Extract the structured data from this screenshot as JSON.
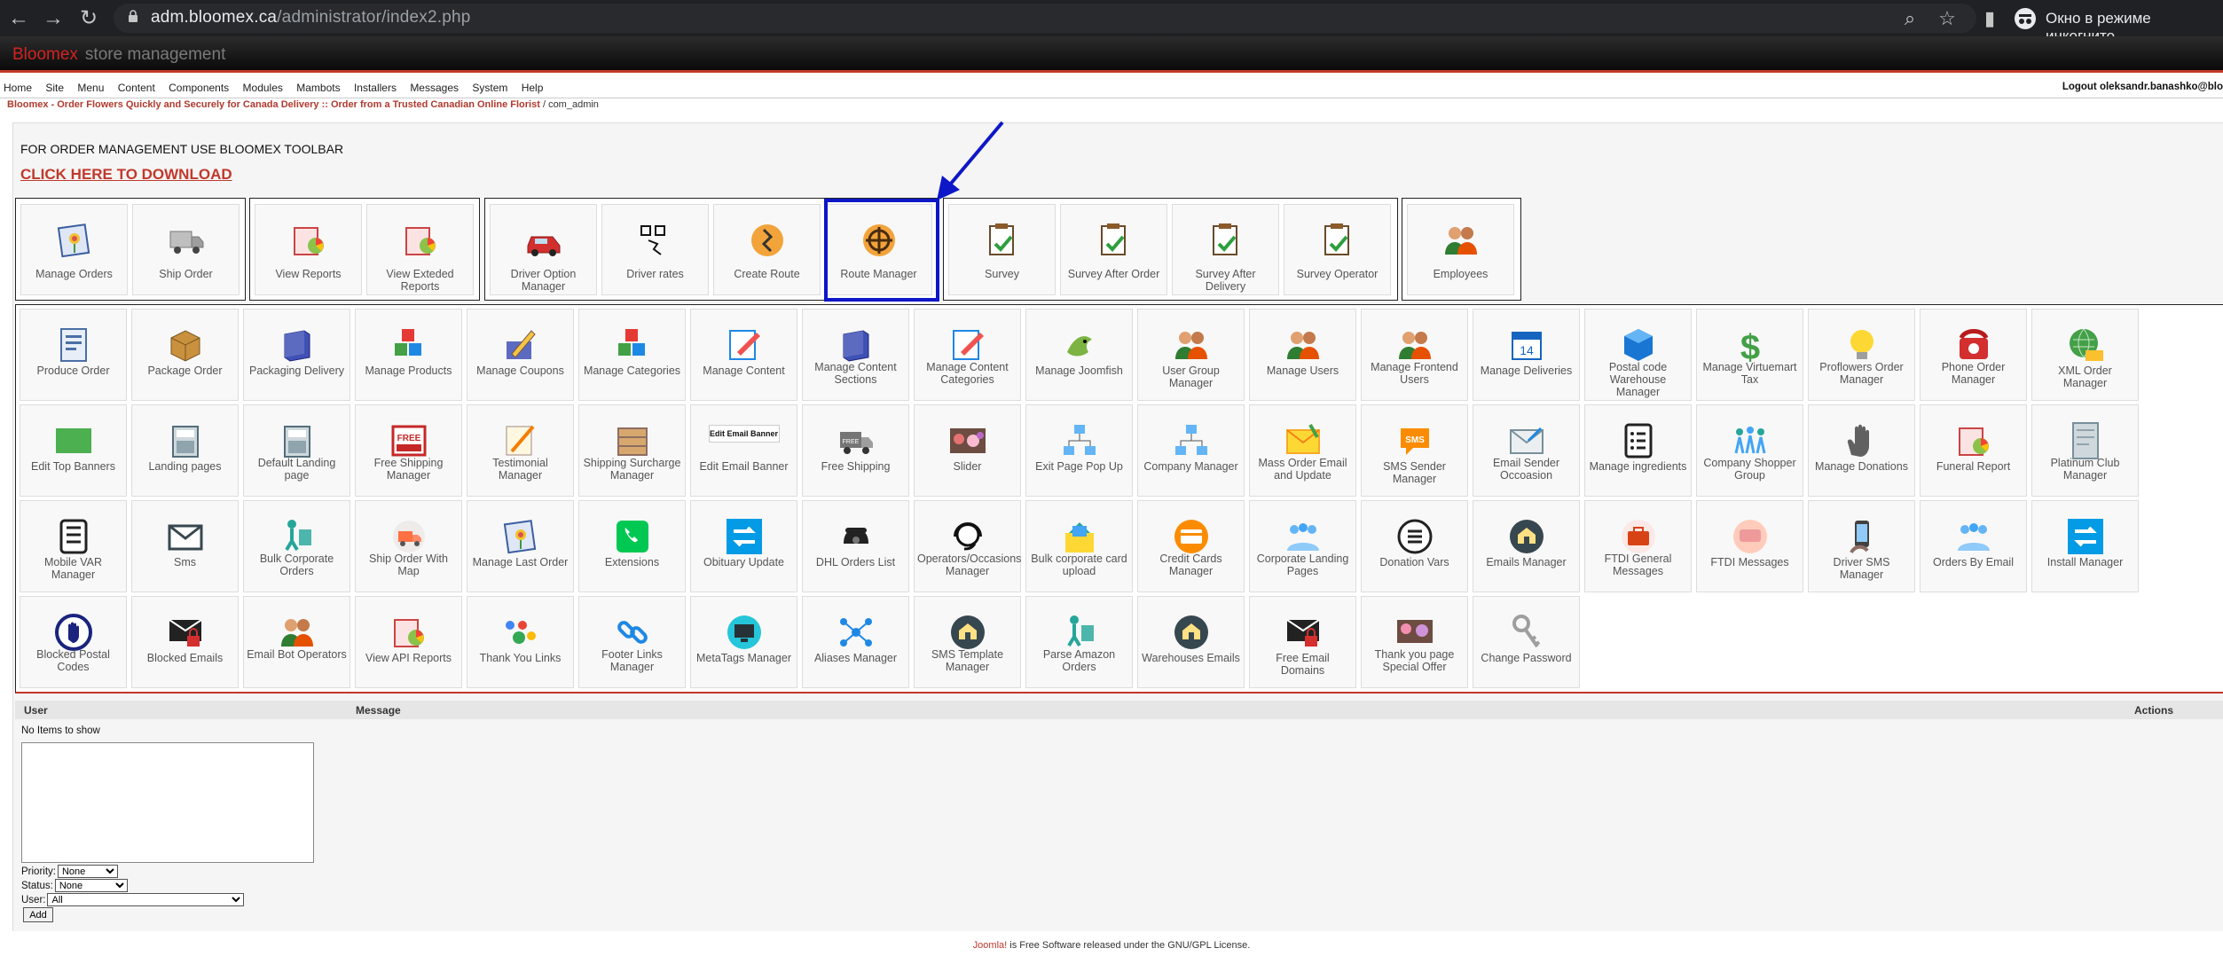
{
  "browser": {
    "url_host": "adm.bloomex.ca",
    "url_path": "/administrator/index2.php",
    "incognito_label": "Окно в режиме инкогнито"
  },
  "header": {
    "brand": "Bloomex",
    "subtitle": "store management"
  },
  "menu": {
    "items": [
      "Home",
      "Site",
      "Menu",
      "Content",
      "Components",
      "Modules",
      "Mambots",
      "Installers",
      "Messages",
      "System",
      "Help"
    ],
    "logout": "Logout oleksandr.banashko@blo"
  },
  "pathway": {
    "link": "Bloomex - Order Flowers Quickly and Securely for Canada Delivery :: Order from a Trusted Canadian Online Florist",
    "current": "/ com_admin"
  },
  "toolbar_note": "FOR ORDER MANAGEMENT USE  BLOOMEX TOOLBAR",
  "download_link": "CLICK HERE TO DOWNLOAD",
  "top_tiles": [
    "Manage Orders",
    "Ship Order",
    "View Reports",
    "View Exteded Reports",
    "Driver Option Manager",
    "Driver rates",
    "Create Route",
    "Route Manager",
    "Survey",
    "Survey After Order",
    "Survey After Delivery",
    "Survey Operator",
    "Employees"
  ],
  "grid_tiles": [
    [
      "Produce Order",
      "Package Order",
      "Packaging Delivery",
      "Manage Products",
      "Manage Coupons",
      "Manage Categories",
      "Manage Content",
      "Manage Content Sections",
      "Manage Content Categories",
      "Manage Joomfish",
      "User Group Manager",
      "Manage Users",
      "Manage Frontend Users",
      "Manage Deliveries",
      "Postal code Warehouse Manager",
      "Manage Virtuemart Tax",
      "Proflowers Order Manager",
      "Phone Order Manager",
      "XML Order Manager"
    ],
    [
      "Edit Top Banners",
      "Landing pages",
      "Default Landing page",
      "Free Shipping Manager",
      "Testimonial Manager",
      "Shipping Surcharge Manager",
      "Edit Email Banner",
      "Free Shipping",
      "Slider",
      "Exit Page Pop Up",
      "Company Manager",
      "Mass Order Email and Update",
      "SMS Sender Manager",
      "Email Sender Occoasion",
      "Manage ingredients",
      "Company Shopper Group",
      "Manage Donations",
      "Funeral Report",
      "Platinum Club Manager"
    ],
    [
      "Mobile VAR Manager",
      "Sms",
      "Bulk Corporate Orders",
      "Ship Order With Map",
      "Manage Last Order",
      "Extensions",
      "Obituary Update",
      "DHL Orders List",
      "Operators/Occasions Manager",
      "Bulk corporate card upload",
      "Credit Cards Manager",
      "Corporate Landing Pages",
      "Donation Vars",
      "Emails Manager",
      "FTDI General Messages",
      "FTDI Messages",
      "Driver SMS Manager",
      "Orders By Email",
      "Install Manager"
    ],
    [
      "Blocked Postal Codes",
      "Blocked Emails",
      "Email Bot Operators",
      "View API Reports",
      "Thank You Links",
      "Footer Links Manager",
      "MetaTags Manager",
      "Aliases Manager",
      "SMS Template Manager",
      "Parse Amazon Orders",
      "Warehouses Emails",
      "Free Email Domains",
      "Thank you page Special Offer",
      "Change Password"
    ]
  ],
  "edit_email_banner_text": "Edit Email Banner",
  "messages": {
    "col_user": "User",
    "col_message": "Message",
    "col_actions": "Actions",
    "empty": "No Items to show",
    "priority_label": "Priority:",
    "priority_value": "None",
    "status_label": "Status:",
    "status_value": "None",
    "user_label": "User:",
    "user_value": "All",
    "add_button": "Add"
  },
  "footer": {
    "joomla": "Joomla!",
    "text": " is Free Software released under the GNU/GPL License."
  }
}
